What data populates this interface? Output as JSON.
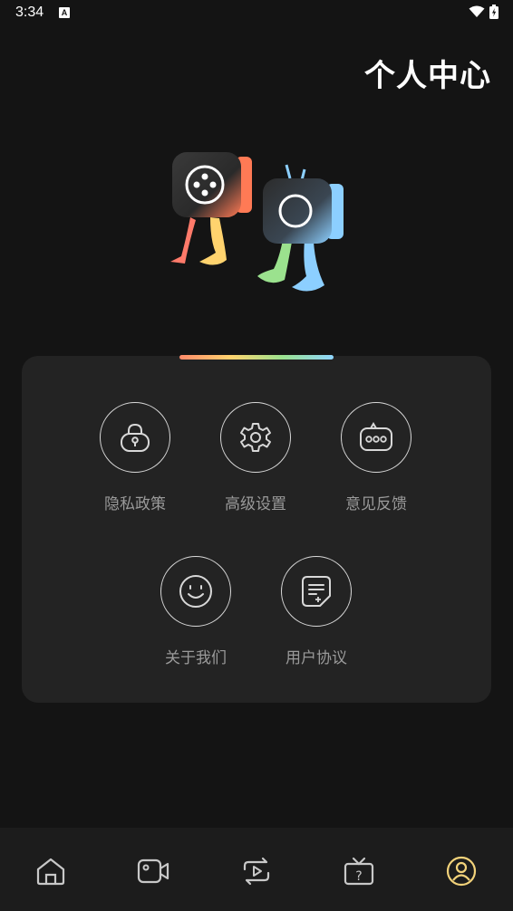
{
  "status": {
    "time": "3:34",
    "notif_letter": "A"
  },
  "header": {
    "title": "个人中心"
  },
  "menu": {
    "items": [
      {
        "label": "隐私政策",
        "icon": "lock-icon"
      },
      {
        "label": "高级设置",
        "icon": "gear-icon"
      },
      {
        "label": "意见反馈",
        "icon": "feedback-icon"
      },
      {
        "label": "关于我们",
        "icon": "smile-icon"
      },
      {
        "label": "用户协议",
        "icon": "document-icon"
      }
    ]
  },
  "nav": {
    "items": [
      {
        "icon": "home-icon"
      },
      {
        "icon": "video-camera-icon"
      },
      {
        "icon": "replay-icon"
      },
      {
        "icon": "tv-help-icon"
      },
      {
        "icon": "profile-icon",
        "active": true
      }
    ],
    "active_color": "#f2d27a"
  },
  "colors": {
    "background": "#141414",
    "card": "#232323",
    "icon_stroke": "#d8d8d8",
    "label": "#9a9a9a"
  }
}
